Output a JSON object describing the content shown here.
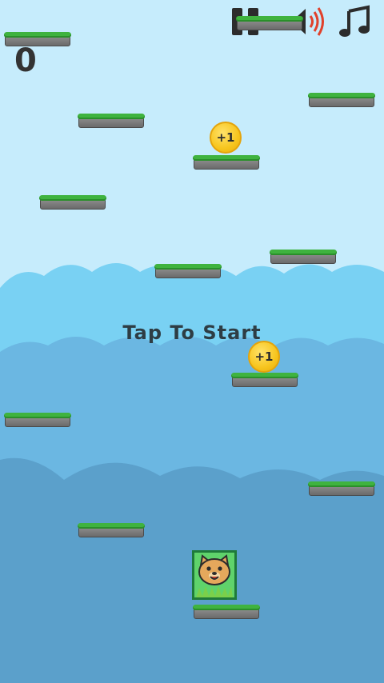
{
  "hud": {
    "score": "0",
    "pause_icon": "pause-icon",
    "sound_icon": "speaker-on-icon",
    "music_icon": "music-note-icon"
  },
  "prompt": "Tap To Start",
  "coins": [
    {
      "label": "+1"
    },
    {
      "label": "+1"
    }
  ],
  "player": {
    "icon": "cat-face-icon"
  },
  "colors": {
    "sky_top": "#bfe9fb",
    "cloud_near": "#5ea6cf",
    "grass": "#3fb33f",
    "stone": "#7a7a7a",
    "coin": "#f7c51e",
    "player_bg": "#5fd36b",
    "text": "#2e3d44"
  }
}
